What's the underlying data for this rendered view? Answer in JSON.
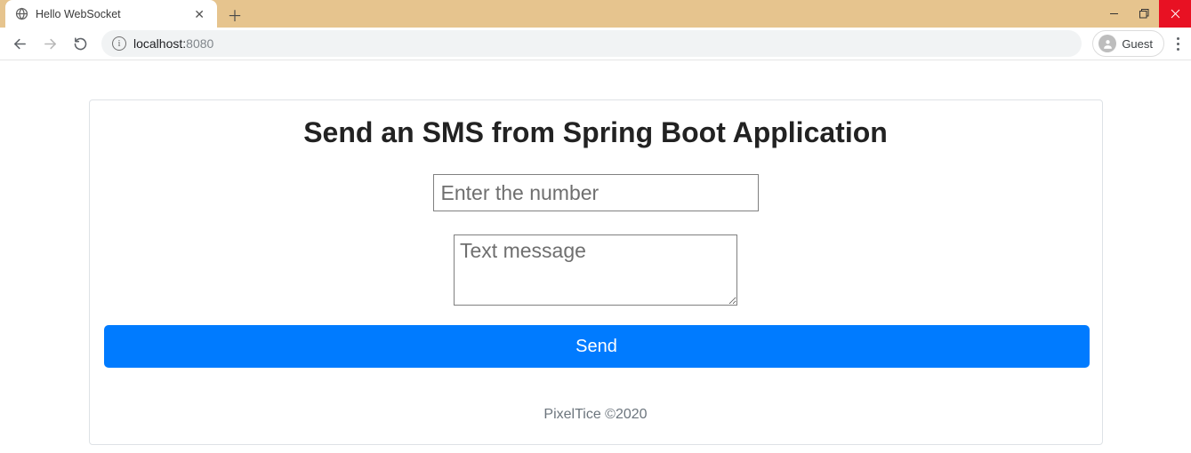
{
  "browser": {
    "tab_title": "Hello WebSocket",
    "url_host": "localhost:",
    "url_port": "8080",
    "profile_label": "Guest"
  },
  "page": {
    "heading": "Send an SMS from Spring Boot Application",
    "number_placeholder": "Enter the number",
    "message_placeholder": "Text message",
    "send_label": "Send",
    "footer": "PixelTice ©2020"
  }
}
